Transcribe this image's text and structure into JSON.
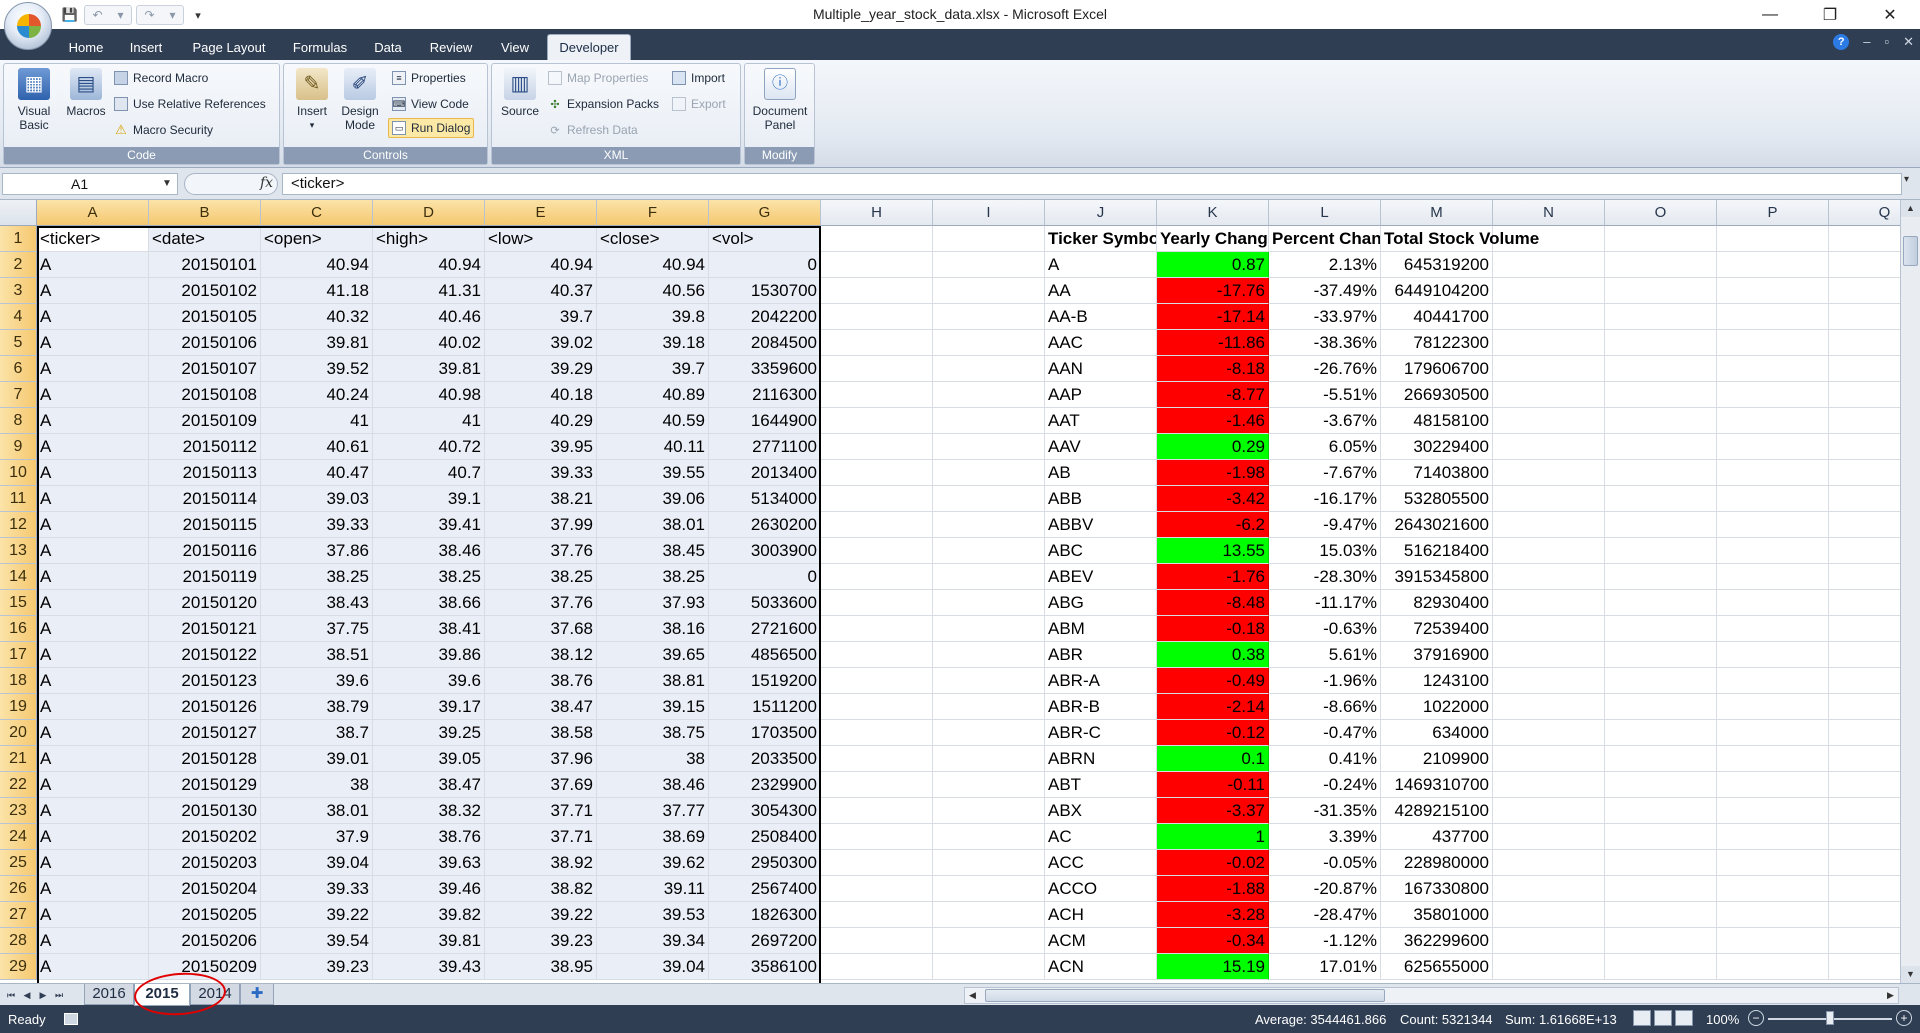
{
  "window": {
    "title": "Multiple_year_stock_data.xlsx - Microsoft Excel",
    "controls": [
      "—",
      "❐",
      "✕"
    ]
  },
  "quick_access": {
    "save": "💾",
    "undo": "↶",
    "redo": "↷",
    "customize": "▾"
  },
  "ribbon_tabs": [
    "Home",
    "Insert",
    "Page Layout",
    "Formulas",
    "Data",
    "Review",
    "View",
    "Developer"
  ],
  "active_tab": "Developer",
  "tab_right_icons": {
    "help": "?",
    "minimize": "–",
    "restore": "▫",
    "close": "✕"
  },
  "ribbon": {
    "code": {
      "label": "Code",
      "visual_basic": [
        "Visual",
        "Basic"
      ],
      "macros": "Macros",
      "record_macro": "Record Macro",
      "relative_refs": "Use Relative References",
      "macro_security": "Macro Security"
    },
    "controls": {
      "label": "Controls",
      "insert": "Insert",
      "design_mode": [
        "Design",
        "Mode"
      ],
      "properties": "Properties",
      "view_code": "View Code",
      "run_dialog": "Run Dialog"
    },
    "xml": {
      "label": "XML",
      "source": "Source",
      "map_properties": "Map Properties",
      "expansion_packs": "Expansion Packs",
      "refresh_data": "Refresh Data",
      "import": "Import",
      "export": "Export"
    },
    "modify": {
      "label": "Modify",
      "document_panel": [
        "Document",
        "Panel"
      ]
    }
  },
  "formula_bar": {
    "name_box": "A1",
    "fx": "fx",
    "formula": "<ticker>"
  },
  "columns": [
    "A",
    "B",
    "C",
    "D",
    "E",
    "F",
    "G",
    "H",
    "I",
    "J",
    "K",
    "L",
    "M",
    "N",
    "O",
    "P",
    "Q"
  ],
  "selected_columns": [
    "A",
    "B",
    "C",
    "D",
    "E",
    "F",
    "G"
  ],
  "rows": [
    {
      "n": "1",
      "a": "<ticker>",
      "b": "<date>",
      "c": "<open>",
      "d": "<high>",
      "e": "<low>",
      "f": "<close>",
      "g": "<vol>",
      "j": "Ticker Symbol",
      "k": "Yearly Change",
      "l": "Percent Change",
      "m": "Total Stock Volume",
      "kc": ""
    },
    {
      "n": "2",
      "a": "A",
      "b": "20150101",
      "c": "40.94",
      "d": "40.94",
      "e": "40.94",
      "f": "40.94",
      "g": "0",
      "j": "A",
      "k": "0.87",
      "l": "2.13%",
      "m": "645319200",
      "kc": "green"
    },
    {
      "n": "3",
      "a": "A",
      "b": "20150102",
      "c": "41.18",
      "d": "41.31",
      "e": "40.37",
      "f": "40.56",
      "g": "1530700",
      "j": "AA",
      "k": "-17.76",
      "l": "-37.49%",
      "m": "6449104200",
      "kc": "red"
    },
    {
      "n": "4",
      "a": "A",
      "b": "20150105",
      "c": "40.32",
      "d": "40.46",
      "e": "39.7",
      "f": "39.8",
      "g": "2042200",
      "j": "AA-B",
      "k": "-17.14",
      "l": "-33.97%",
      "m": "40441700",
      "kc": "red"
    },
    {
      "n": "5",
      "a": "A",
      "b": "20150106",
      "c": "39.81",
      "d": "40.02",
      "e": "39.02",
      "f": "39.18",
      "g": "2084500",
      "j": "AAC",
      "k": "-11.86",
      "l": "-38.36%",
      "m": "78122300",
      "kc": "red"
    },
    {
      "n": "6",
      "a": "A",
      "b": "20150107",
      "c": "39.52",
      "d": "39.81",
      "e": "39.29",
      "f": "39.7",
      "g": "3359600",
      "j": "AAN",
      "k": "-8.18",
      "l": "-26.76%",
      "m": "179606700",
      "kc": "red"
    },
    {
      "n": "7",
      "a": "A",
      "b": "20150108",
      "c": "40.24",
      "d": "40.98",
      "e": "40.18",
      "f": "40.89",
      "g": "2116300",
      "j": "AAP",
      "k": "-8.77",
      "l": "-5.51%",
      "m": "266930500",
      "kc": "red"
    },
    {
      "n": "8",
      "a": "A",
      "b": "20150109",
      "c": "41",
      "d": "41",
      "e": "40.29",
      "f": "40.59",
      "g": "1644900",
      "j": "AAT",
      "k": "-1.46",
      "l": "-3.67%",
      "m": "48158100",
      "kc": "red"
    },
    {
      "n": "9",
      "a": "A",
      "b": "20150112",
      "c": "40.61",
      "d": "40.72",
      "e": "39.95",
      "f": "40.11",
      "g": "2771100",
      "j": "AAV",
      "k": "0.29",
      "l": "6.05%",
      "m": "30229400",
      "kc": "green"
    },
    {
      "n": "10",
      "a": "A",
      "b": "20150113",
      "c": "40.47",
      "d": "40.7",
      "e": "39.33",
      "f": "39.55",
      "g": "2013400",
      "j": "AB",
      "k": "-1.98",
      "l": "-7.67%",
      "m": "71403800",
      "kc": "red"
    },
    {
      "n": "11",
      "a": "A",
      "b": "20150114",
      "c": "39.03",
      "d": "39.1",
      "e": "38.21",
      "f": "39.06",
      "g": "5134000",
      "j": "ABB",
      "k": "-3.42",
      "l": "-16.17%",
      "m": "532805500",
      "kc": "red"
    },
    {
      "n": "12",
      "a": "A",
      "b": "20150115",
      "c": "39.33",
      "d": "39.41",
      "e": "37.99",
      "f": "38.01",
      "g": "2630200",
      "j": "ABBV",
      "k": "-6.2",
      "l": "-9.47%",
      "m": "2643021600",
      "kc": "red"
    },
    {
      "n": "13",
      "a": "A",
      "b": "20150116",
      "c": "37.86",
      "d": "38.46",
      "e": "37.76",
      "f": "38.45",
      "g": "3003900",
      "j": "ABC",
      "k": "13.55",
      "l": "15.03%",
      "m": "516218400",
      "kc": "green"
    },
    {
      "n": "14",
      "a": "A",
      "b": "20150119",
      "c": "38.25",
      "d": "38.25",
      "e": "38.25",
      "f": "38.25",
      "g": "0",
      "j": "ABEV",
      "k": "-1.76",
      "l": "-28.30%",
      "m": "3915345800",
      "kc": "red"
    },
    {
      "n": "15",
      "a": "A",
      "b": "20150120",
      "c": "38.43",
      "d": "38.66",
      "e": "37.76",
      "f": "37.93",
      "g": "5033600",
      "j": "ABG",
      "k": "-8.48",
      "l": "-11.17%",
      "m": "82930400",
      "kc": "red"
    },
    {
      "n": "16",
      "a": "A",
      "b": "20150121",
      "c": "37.75",
      "d": "38.41",
      "e": "37.68",
      "f": "38.16",
      "g": "2721600",
      "j": "ABM",
      "k": "-0.18",
      "l": "-0.63%",
      "m": "72539400",
      "kc": "red"
    },
    {
      "n": "17",
      "a": "A",
      "b": "20150122",
      "c": "38.51",
      "d": "39.86",
      "e": "38.12",
      "f": "39.65",
      "g": "4856500",
      "j": "ABR",
      "k": "0.38",
      "l": "5.61%",
      "m": "37916900",
      "kc": "green"
    },
    {
      "n": "18",
      "a": "A",
      "b": "20150123",
      "c": "39.6",
      "d": "39.6",
      "e": "38.76",
      "f": "38.81",
      "g": "1519200",
      "j": "ABR-A",
      "k": "-0.49",
      "l": "-1.96%",
      "m": "1243100",
      "kc": "red"
    },
    {
      "n": "19",
      "a": "A",
      "b": "20150126",
      "c": "38.79",
      "d": "39.17",
      "e": "38.47",
      "f": "39.15",
      "g": "1511200",
      "j": "ABR-B",
      "k": "-2.14",
      "l": "-8.66%",
      "m": "1022000",
      "kc": "red"
    },
    {
      "n": "20",
      "a": "A",
      "b": "20150127",
      "c": "38.7",
      "d": "39.25",
      "e": "38.58",
      "f": "38.75",
      "g": "1703500",
      "j": "ABR-C",
      "k": "-0.12",
      "l": "-0.47%",
      "m": "634000",
      "kc": "red"
    },
    {
      "n": "21",
      "a": "A",
      "b": "20150128",
      "c": "39.01",
      "d": "39.05",
      "e": "37.96",
      "f": "38",
      "g": "2033500",
      "j": "ABRN",
      "k": "0.1",
      "l": "0.41%",
      "m": "2109900",
      "kc": "green"
    },
    {
      "n": "22",
      "a": "A",
      "b": "20150129",
      "c": "38",
      "d": "38.47",
      "e": "37.69",
      "f": "38.46",
      "g": "2329900",
      "j": "ABT",
      "k": "-0.11",
      "l": "-0.24%",
      "m": "1469310700",
      "kc": "red"
    },
    {
      "n": "23",
      "a": "A",
      "b": "20150130",
      "c": "38.01",
      "d": "38.32",
      "e": "37.71",
      "f": "37.77",
      "g": "3054300",
      "j": "ABX",
      "k": "-3.37",
      "l": "-31.35%",
      "m": "4289215100",
      "kc": "red"
    },
    {
      "n": "24",
      "a": "A",
      "b": "20150202",
      "c": "37.9",
      "d": "38.76",
      "e": "37.71",
      "f": "38.69",
      "g": "2508400",
      "j": "AC",
      "k": "1",
      "l": "3.39%",
      "m": "437700",
      "kc": "green"
    },
    {
      "n": "25",
      "a": "A",
      "b": "20150203",
      "c": "39.04",
      "d": "39.63",
      "e": "38.92",
      "f": "39.62",
      "g": "2950300",
      "j": "ACC",
      "k": "-0.02",
      "l": "-0.05%",
      "m": "228980000",
      "kc": "red"
    },
    {
      "n": "26",
      "a": "A",
      "b": "20150204",
      "c": "39.33",
      "d": "39.46",
      "e": "38.82",
      "f": "39.11",
      "g": "2567400",
      "j": "ACCO",
      "k": "-1.88",
      "l": "-20.87%",
      "m": "167330800",
      "kc": "red"
    },
    {
      "n": "27",
      "a": "A",
      "b": "20150205",
      "c": "39.22",
      "d": "39.82",
      "e": "39.22",
      "f": "39.53",
      "g": "1826300",
      "j": "ACH",
      "k": "-3.28",
      "l": "-28.47%",
      "m": "35801000",
      "kc": "red"
    },
    {
      "n": "28",
      "a": "A",
      "b": "20150206",
      "c": "39.54",
      "d": "39.81",
      "e": "39.23",
      "f": "39.34",
      "g": "2697200",
      "j": "ACM",
      "k": "-0.34",
      "l": "-1.12%",
      "m": "362299600",
      "kc": "red"
    },
    {
      "n": "29",
      "a": "A",
      "b": "20150209",
      "c": "39.23",
      "d": "39.43",
      "e": "38.95",
      "f": "39.04",
      "g": "3586100",
      "j": "ACN",
      "k": "15.19",
      "l": "17.01%",
      "m": "625655000",
      "kc": "green"
    }
  ],
  "sheet_tabs": [
    "2016",
    "2015",
    "2014"
  ],
  "active_sheet": "2015",
  "new_sheet_icon": "✚",
  "status": {
    "ready": "Ready",
    "average": "Average: 3544461.866",
    "count": "Count: 5321344",
    "sum": "Sum: 1.61668E+13",
    "zoom": "100%"
  },
  "colors": {
    "positive": "#00ff00",
    "negative": "#ff0000",
    "selection": "#eaeef7",
    "annotation_circle": "#e00000"
  }
}
